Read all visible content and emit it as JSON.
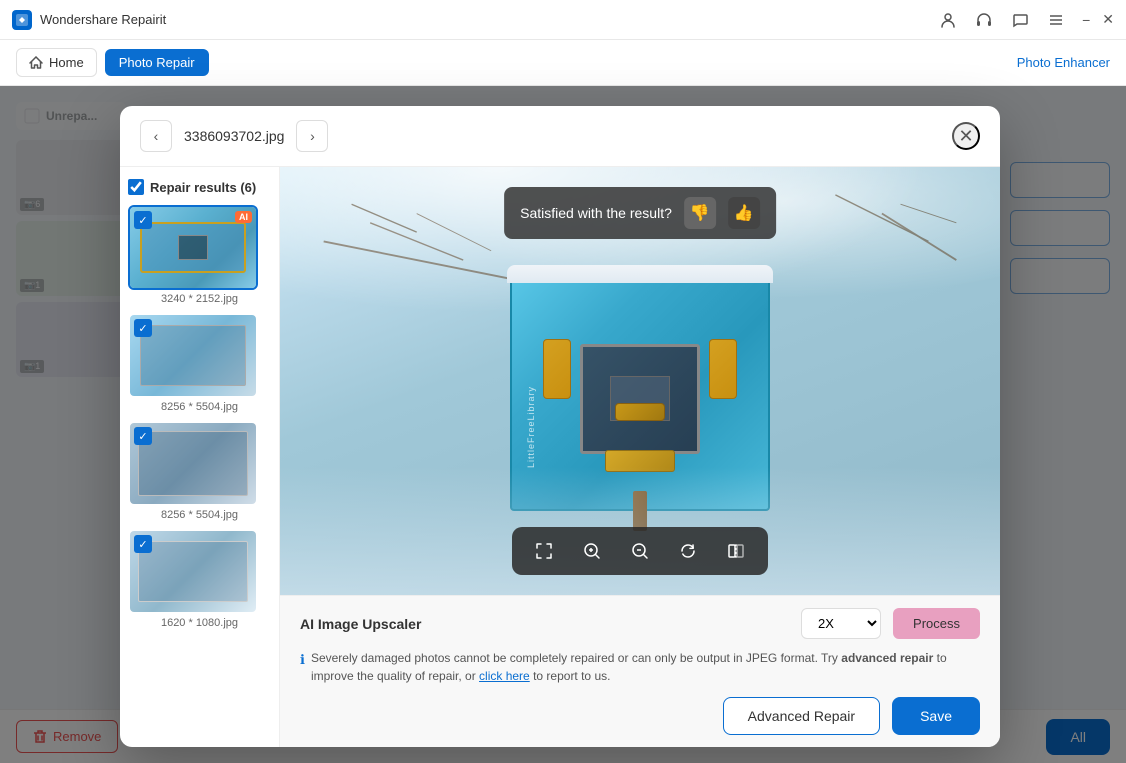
{
  "app": {
    "title": "Wondershare Repairit",
    "icon": "R"
  },
  "titlebar": {
    "icons": [
      "user-icon",
      "headphone-icon",
      "chat-icon",
      "menu-icon"
    ],
    "minimize": "−",
    "close": "✕"
  },
  "navbar": {
    "home_label": "Home",
    "active_tab": "Photo Repair",
    "photo_enhancer": "Photo Enhancer"
  },
  "modal": {
    "filename": "3386093702.jpg",
    "close_label": "✕",
    "prev_label": "‹",
    "next_label": "›",
    "repair_results_label": "Repair results (6)",
    "satisfied_text": "Satisfied with the result?",
    "items": [
      {
        "label": "3240 * 2152.jpg",
        "active": true,
        "ai": true,
        "checked": true
      },
      {
        "label": "8256 * 5504.jpg",
        "active": false,
        "ai": false,
        "checked": true
      },
      {
        "label": "8256 * 5504.jpg",
        "active": false,
        "ai": false,
        "checked": true
      },
      {
        "label": "1620 * 1080.jpg",
        "active": false,
        "ai": false,
        "checked": true
      }
    ],
    "upscaler_label": "AI Image Upscaler",
    "upscaler_value": "2X",
    "process_label": "Process",
    "info_text": "Severely damaged photos cannot be completely repaired or can only be output in JPEG format. Try",
    "info_bold": "advanced repair",
    "info_text2": "to improve the quality of repair, or",
    "info_link": "click here",
    "info_text3": "to report to us.",
    "advanced_repair_label": "Advanced Repair",
    "save_label": "Save"
  },
  "bottom_bar": {
    "remove_label": "Remove",
    "repair_all_label": "All"
  },
  "colors": {
    "primary": "#0a6ed1",
    "process_btn": "#e8a0c0",
    "danger": "#e55555"
  }
}
